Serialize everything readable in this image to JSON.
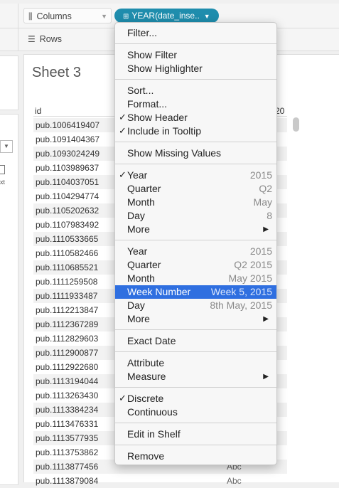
{
  "shelves": {
    "columns_label": "Columns",
    "rows_label": "Rows",
    "pill_label": "YEAR(date_inse.."
  },
  "left_panel": {
    "partial_text": "xt"
  },
  "sheet": {
    "title": "Sheet 3",
    "col_header": "id",
    "col_header_right": "20",
    "rows": [
      {
        "id": "pub.1006419407",
        "val": ""
      },
      {
        "id": "pub.1091404367",
        "val": ""
      },
      {
        "id": "pub.1093024249",
        "val": ""
      },
      {
        "id": "pub.1103989637",
        "val": ""
      },
      {
        "id": "pub.1104037051",
        "val": ""
      },
      {
        "id": "pub.1104294774",
        "val": ""
      },
      {
        "id": "pub.1105202632",
        "val": ""
      },
      {
        "id": "pub.1107983492",
        "val": ""
      },
      {
        "id": "pub.1110533665",
        "val": ""
      },
      {
        "id": "pub.1110582466",
        "val": ""
      },
      {
        "id": "pub.1110685521",
        "val": ""
      },
      {
        "id": "pub.1111259508",
        "val": ""
      },
      {
        "id": "pub.1111933487",
        "val": ""
      },
      {
        "id": "pub.1112213847",
        "val": ""
      },
      {
        "id": "pub.1112367289",
        "val": ""
      },
      {
        "id": "pub.1112829603",
        "val": ""
      },
      {
        "id": "pub.1112900877",
        "val": ""
      },
      {
        "id": "pub.1112922680",
        "val": ""
      },
      {
        "id": "pub.1113194044",
        "val": ""
      },
      {
        "id": "pub.1113263430",
        "val": ""
      },
      {
        "id": "pub.1113384234",
        "val": ""
      },
      {
        "id": "pub.1113476331",
        "val": ""
      },
      {
        "id": "pub.1113577935",
        "val": ""
      },
      {
        "id": "pub.1113753862",
        "val": ""
      },
      {
        "id": "pub.1113877456",
        "val": "Abc"
      },
      {
        "id": "pub.1113879084",
        "val": "Abc"
      }
    ]
  },
  "menu": {
    "filter": "Filter...",
    "show_filter": "Show Filter",
    "show_highlighter": "Show Highlighter",
    "sort": "Sort...",
    "format": "Format...",
    "show_header": "Show Header",
    "include_tooltip": "Include in Tooltip",
    "show_missing": "Show Missing Values",
    "year1": "Year",
    "year1_val": "2015",
    "quarter1": "Quarter",
    "quarter1_val": "Q2",
    "month1": "Month",
    "month1_val": "May",
    "day1": "Day",
    "day1_val": "8",
    "more1": "More",
    "year2": "Year",
    "year2_val": "2015",
    "quarter2": "Quarter",
    "quarter2_val": "Q2 2015",
    "month2": "Month",
    "month2_val": "May 2015",
    "week_number": "Week Number",
    "week_number_val": "Week 5, 2015",
    "day2": "Day",
    "day2_val": "8th May, 2015",
    "more2": "More",
    "exact_date": "Exact Date",
    "attribute": "Attribute",
    "measure": "Measure",
    "discrete": "Discrete",
    "continuous": "Continuous",
    "edit_in_shelf": "Edit in Shelf",
    "remove": "Remove",
    "check_glyph": "✓",
    "arrow_glyph": "▶"
  },
  "colors": {
    "pill": "#1f8dad",
    "highlight": "#2f6fe0"
  }
}
